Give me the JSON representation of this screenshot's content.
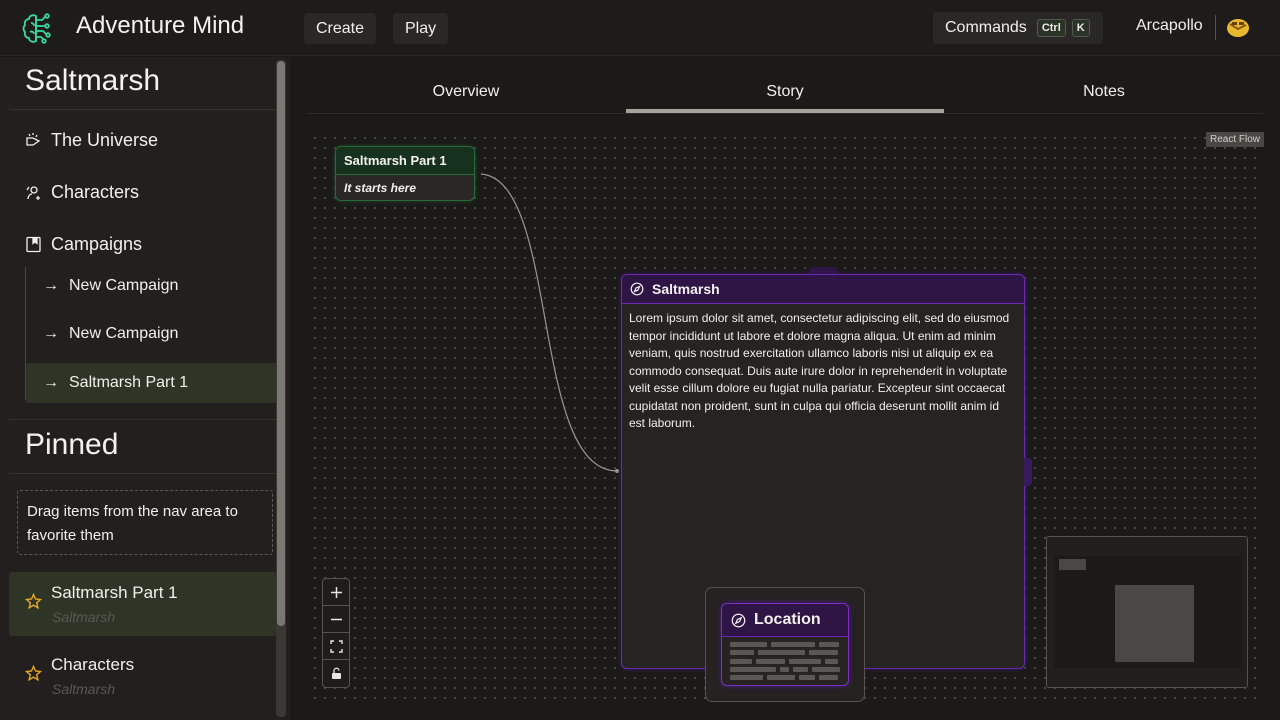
{
  "topbar": {
    "app_title": "Adventure Mind",
    "create_label": "Create",
    "play_label": "Play",
    "commands_label": "Commands",
    "shortcut_keys": [
      "Ctrl",
      "K"
    ],
    "user_name": "Arcapollo",
    "brand_color": "#3ad6a0"
  },
  "sidebar": {
    "world_title": "Saltmarsh",
    "nav": [
      {
        "label": "The Universe",
        "icon": "universe-icon"
      },
      {
        "label": "Characters",
        "icon": "characters-icon"
      },
      {
        "label": "Campaigns",
        "icon": "campaigns-icon"
      }
    ],
    "campaigns": [
      {
        "label": "New Campaign",
        "active": false
      },
      {
        "label": "New Campaign",
        "active": false
      },
      {
        "label": "Saltmarsh Part 1",
        "active": true
      }
    ],
    "pinned_title": "Pinned",
    "pinned_hint": "Drag items from the nav area to favorite them",
    "pinned_items": [
      {
        "title": "Saltmarsh Part 1",
        "subtitle": "Saltmarsh",
        "active": true
      },
      {
        "title": "Characters",
        "subtitle": "Saltmarsh",
        "active": false
      }
    ]
  },
  "tabs": [
    {
      "label": "Overview",
      "active": false
    },
    {
      "label": "Story",
      "active": true
    },
    {
      "label": "Notes",
      "active": false
    }
  ],
  "flow": {
    "attribution": "React Flow",
    "start_node": {
      "title": "Saltmarsh Part 1",
      "subtitle": "It starts here",
      "color": "#2a6a38"
    },
    "location_node": {
      "title": "Saltmarsh",
      "color": "#6a2ab0",
      "body": "Lorem ipsum dolor sit amet, consectetur adipiscing elit, sed do eiusmod tempor incididunt ut labore et dolore magna aliqua. Ut enim ad minim veniam, quis nostrud exercitation ullamco laboris nisi ut aliquip ex ea commodo consequat. Duis aute irure dolor in reprehenderit in voluptate velit esse cillum dolore eu fugiat nulla pariatur. Excepteur sint occaecat cupidatat non proident, sunt in culpa qui officia deserunt mollit anim id est laborum."
    },
    "drag_preview": {
      "title": "Location"
    },
    "controls": [
      "zoom-in",
      "zoom-out",
      "fit-view",
      "toggle-interactivity"
    ]
  }
}
